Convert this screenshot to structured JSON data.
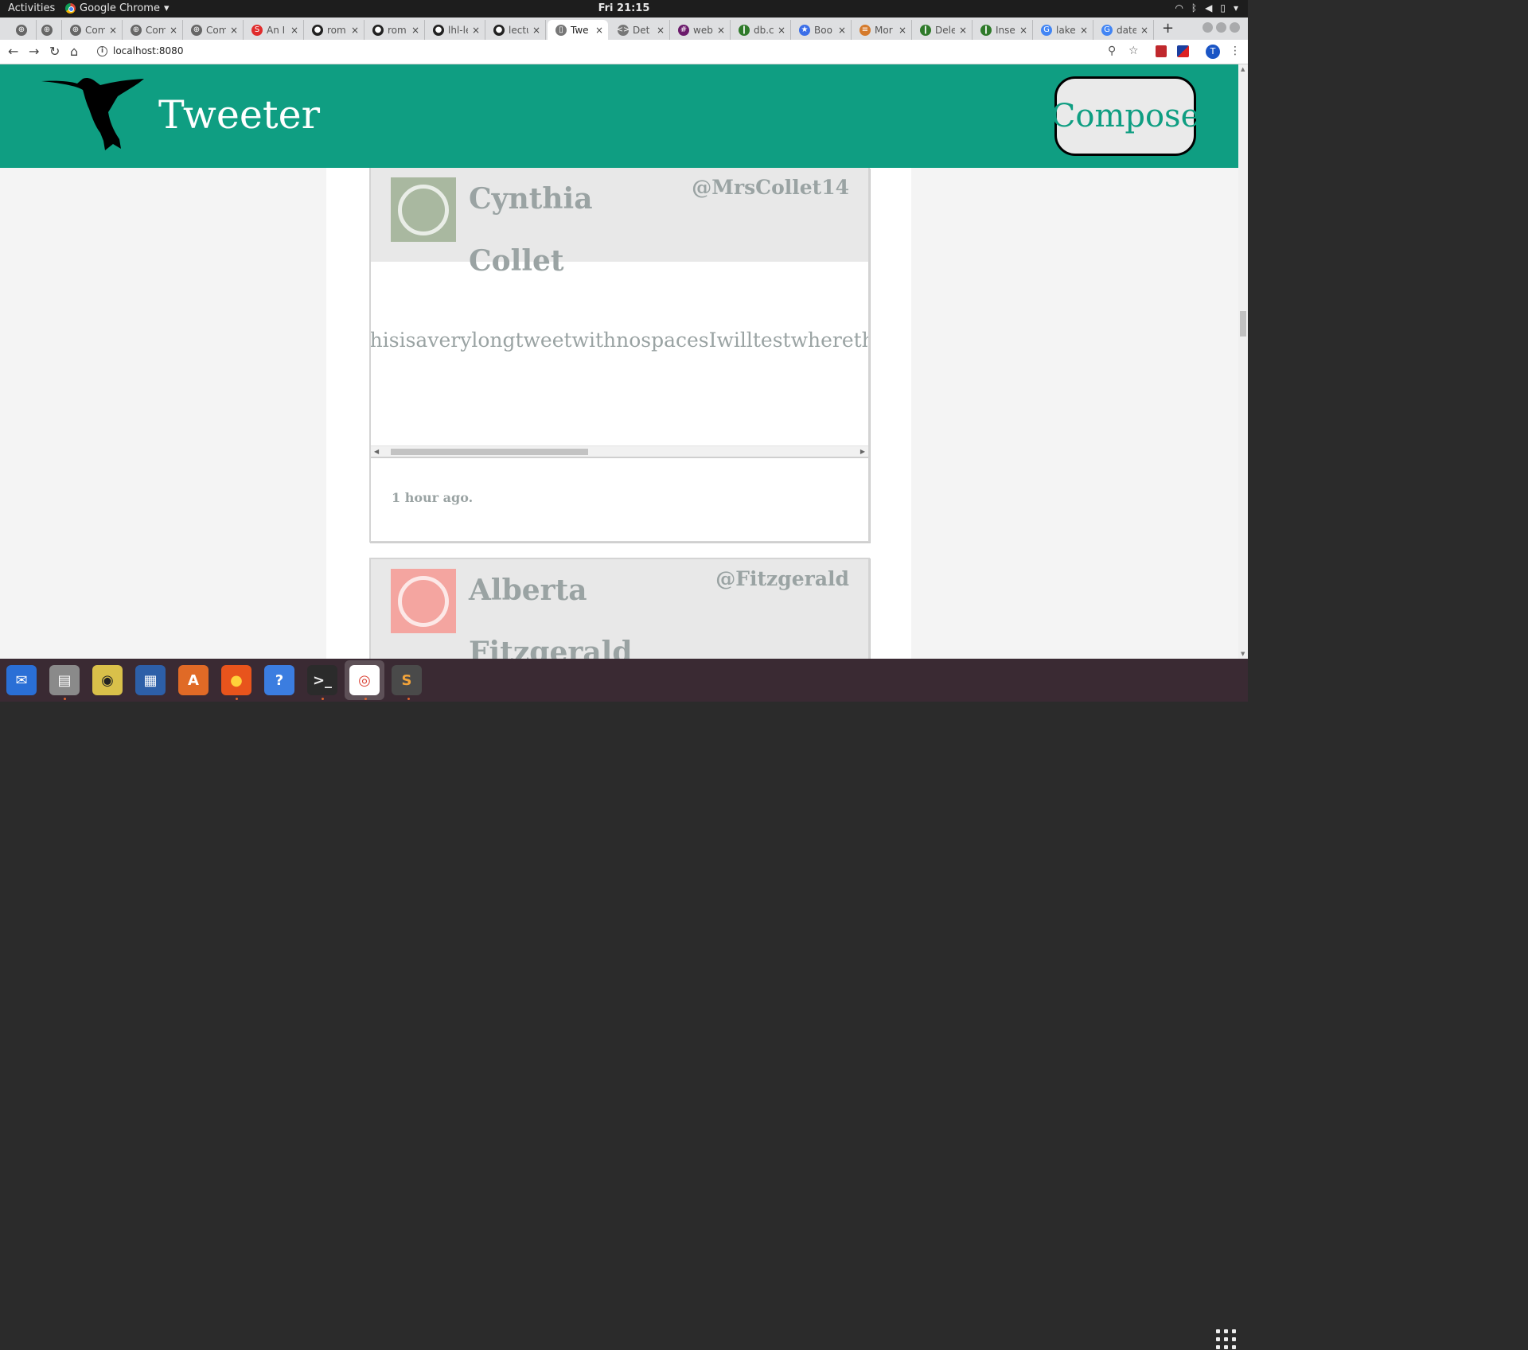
{
  "topbar": {
    "activities": "Activities",
    "app_name": "Google Chrome",
    "clock": "Fri 21:15"
  },
  "tabs": [
    {
      "title": "",
      "favicon": "settings-icon"
    },
    {
      "title": "",
      "favicon": "settings-icon"
    },
    {
      "title": "Com",
      "favicon": "settings-icon"
    },
    {
      "title": "Com",
      "favicon": "settings-icon"
    },
    {
      "title": "Com",
      "favicon": "settings-icon"
    },
    {
      "title": "An I",
      "favicon": "scribd-icon"
    },
    {
      "title": "rom",
      "favicon": "github-icon"
    },
    {
      "title": "rom",
      "favicon": "github-icon"
    },
    {
      "title": "lhl-le",
      "favicon": "github-icon"
    },
    {
      "title": "lectu",
      "favicon": "github-icon"
    },
    {
      "title": "Twe",
      "favicon": "page-icon",
      "active": true
    },
    {
      "title": "Det",
      "favicon": "code-icon"
    },
    {
      "title": "web",
      "favicon": "slack-icon"
    },
    {
      "title": "db.c",
      "favicon": "mongodb-icon"
    },
    {
      "title": "Boo",
      "favicon": "star-icon"
    },
    {
      "title": "Mor",
      "favicon": "stackoverflow-icon"
    },
    {
      "title": "Dele",
      "favicon": "mongodb-icon"
    },
    {
      "title": "Inse",
      "favicon": "mongodb-icon"
    },
    {
      "title": "lake",
      "favicon": "google-icon"
    },
    {
      "title": "date",
      "favicon": "google-icon"
    }
  ],
  "address_bar": {
    "url": "localhost:8080"
  },
  "site": {
    "brand": "Tweeter",
    "compose_label": "Compose"
  },
  "tweets": [
    {
      "name": "Cynthia Collet",
      "handle": "@MrsCollet14",
      "text": "ThisisaverylongtweetwithnospacesIwilltestwherethetextwillgo",
      "time": "1 hour ago.",
      "avatar_color": "#a9b8a0"
    },
    {
      "name": "Alberta Fitzgerald",
      "handle": "@Fitzgerald",
      "avatar_color": "#f4a5a0"
    }
  ],
  "colors": {
    "header_bg": "#0f9e82",
    "accent": "#0f9e82",
    "muted_text": "#9aa3a3"
  },
  "dock": [
    {
      "name": "thunderbird-icon",
      "glyph": "✉"
    },
    {
      "name": "files-icon",
      "glyph": "▤"
    },
    {
      "name": "rhythmbox-icon",
      "glyph": "◉"
    },
    {
      "name": "writer-icon",
      "glyph": "▦"
    },
    {
      "name": "software-center-icon",
      "glyph": "A"
    },
    {
      "name": "firefox-icon",
      "glyph": "●"
    },
    {
      "name": "help-icon",
      "glyph": "?"
    },
    {
      "name": "terminal-icon",
      "glyph": ">_"
    },
    {
      "name": "chrome-icon",
      "glyph": "◎"
    },
    {
      "name": "sublime-icon",
      "glyph": "S"
    }
  ]
}
